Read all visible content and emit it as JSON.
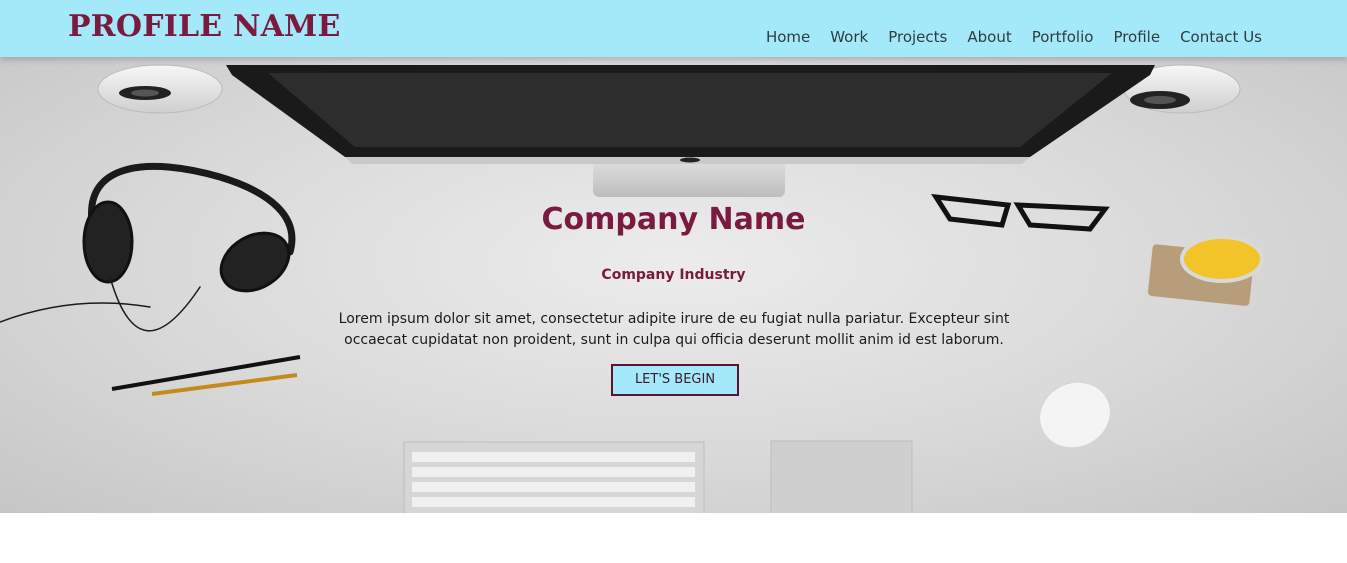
{
  "brand": "PROFILE NAME",
  "nav": {
    "items": [
      "Home",
      "Work",
      "Projects",
      "About",
      "Portfolio",
      "Profile",
      "Contact Us"
    ]
  },
  "hero": {
    "title": "Company Name",
    "subtitle": "Company Industry",
    "description": "Lorem ipsum dolor sit amet, consectetur adipite irure de eu fugiat nulla pariatur. Excepteur sint occaecat cupidatat non proident, sunt in culpa qui officia deserunt mollit anim id est laborum.",
    "cta_label": "LET'S BEGIN"
  },
  "colors": {
    "navbar_bg": "#a3e9f9",
    "brand": "#7b1a3f",
    "nav_text": "#333a40",
    "button_border": "#5a1330"
  }
}
